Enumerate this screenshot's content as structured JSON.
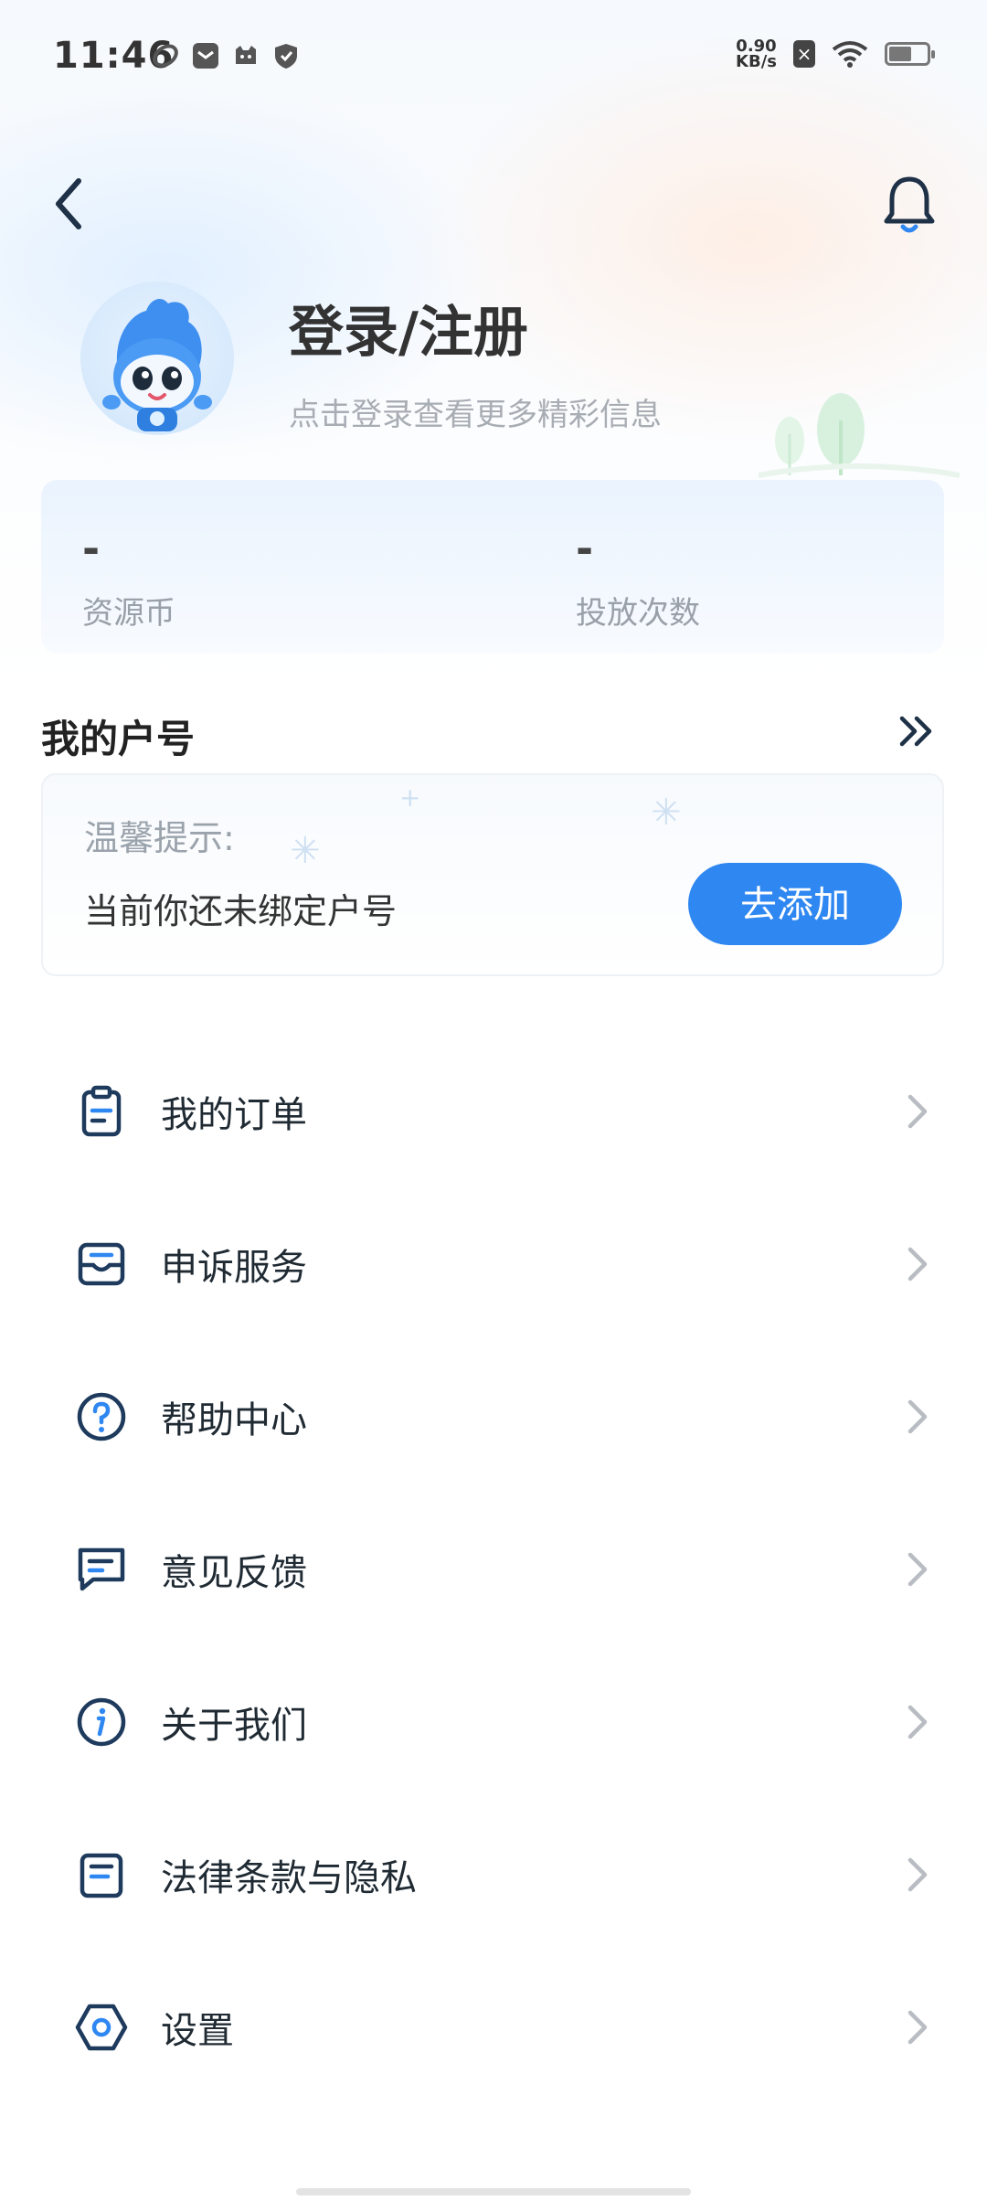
{
  "status_bar": {
    "time": "11:46",
    "net_speed_value": "0.90",
    "net_speed_unit": "KB/s",
    "icons_left": [
      "moon-icon",
      "mail-icon",
      "cat-icon",
      "shield-icon"
    ],
    "icons_right": [
      "sim-x-icon",
      "wifi-icon",
      "battery-icon"
    ]
  },
  "header": {
    "back_icon": "chevron-left-icon",
    "bell_icon": "bell-icon"
  },
  "profile": {
    "title": "登录/注册",
    "subtitle": "点击登录查看更多精彩信息"
  },
  "stats": [
    {
      "value": "-",
      "label": "资源币"
    },
    {
      "value": "-",
      "label": "投放次数"
    }
  ],
  "account": {
    "title": "我的户号",
    "tip_label": "温馨提示:",
    "tip_text": "当前你还未绑定户号",
    "add_button": "去添加"
  },
  "menu": [
    {
      "label": "我的订单",
      "icon": "clipboard-icon"
    },
    {
      "label": "申诉服务",
      "icon": "inbox-icon"
    },
    {
      "label": "帮助中心",
      "icon": "question-circle-icon"
    },
    {
      "label": "意见反馈",
      "icon": "message-icon"
    },
    {
      "label": "关于我们",
      "icon": "info-circle-icon"
    },
    {
      "label": "法律条款与隐私",
      "icon": "document-icon"
    },
    {
      "label": "设置",
      "icon": "hexagon-settings-icon"
    }
  ],
  "colors": {
    "accent": "#2f87f1",
    "icon_dark": "#1e3a5c",
    "chevron": "#b9bdc3"
  }
}
